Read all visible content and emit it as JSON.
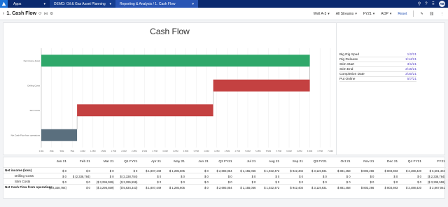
{
  "nav": {
    "apps": "Apps",
    "model": "DEMO: Oil & Gas Asset Planning",
    "page": "Reporting & Analysis / 1. Cash Flow",
    "avatar": "AB"
  },
  "header": {
    "title": "1. Cash Flow",
    "selectors": [
      "Well A-3",
      "All Streams",
      "FY21",
      "AOP"
    ],
    "reset": "Reset"
  },
  "chart_data": {
    "type": "bar",
    "title": "Cash Flow",
    "orientation": "horizontal-waterfall",
    "categories": [
      "Net income (loss)",
      "Drilling Costs",
      "Stim Costs",
      "Net Cash Flow from operations"
    ],
    "bars": [
      {
        "start": 0,
        "end": 6501404,
        "color": "#2fa86a"
      },
      {
        "start": 6501404,
        "end": 4162620,
        "color": "#c44141"
      },
      {
        "start": 4162620,
        "end": 866061,
        "color": "#c44141"
      },
      {
        "start": 0,
        "end": 866061,
        "color": "#5a6f7e"
      }
    ],
    "xlim": [
      0,
      7000000
    ],
    "xticks": [
      "0.00k",
      "250k",
      "500k",
      "750k",
      "1.00M",
      "1.25M",
      "1.50M",
      "1.75M",
      "2.00M",
      "2.25M",
      "2.50M",
      "2.75M",
      "3.00M",
      "3.25M",
      "3.50M",
      "3.75M",
      "4.00M",
      "4.25M",
      "4.50M",
      "4.75M",
      "5.00M",
      "5.25M",
      "5.50M",
      "5.75M",
      "6.00M",
      "6.25M",
      "6.50M",
      "6.75M",
      "7.00M"
    ]
  },
  "timeline": {
    "rows": [
      {
        "label": "Big Rig Spud",
        "value": "1/2/21"
      },
      {
        "label": "Rig Release",
        "value": "1/14/21"
      },
      {
        "label": "Stim Start",
        "value": "3/1/21"
      },
      {
        "label": "Stim End",
        "value": "3/16/21"
      },
      {
        "label": "Completion Date",
        "value": "3/30/21"
      },
      {
        "label": "Put Online",
        "value": "5/7/21"
      }
    ]
  },
  "table": {
    "columns": [
      "Jan 21",
      "Feb 21",
      "Mar 21",
      "Q1 FY21",
      "Apr 21",
      "May 21",
      "Jun 21",
      "Q2 FY21",
      "Jul 21",
      "Aug 21",
      "Sep 21",
      "Q3 FY21",
      "Oct 21",
      "Nov 21",
      "Dec 21",
      "Q4 FY21",
      "FY21"
    ],
    "rows": [
      {
        "label": "Net income (loss)",
        "bold": true,
        "values": [
          "$ 0",
          "$ 0",
          "$ 0",
          "$ 0",
          "$ 1,807,449",
          "$ 1,285,605",
          "$ 0",
          "$ 2,693,054",
          "$ 1,155,056",
          "$ 1,022,472",
          "$ 942,404",
          "$ 3,119,931",
          "$ 881,458",
          "$ 803,266",
          "$ 803,693",
          "$ 2,488,420",
          "$ 6,501,404"
        ]
      },
      {
        "label": "Drilling Costs",
        "bold": false,
        "values": [
          "$ 0",
          "$ (2,338,784)",
          "$ 0",
          "$ (2,338,784)",
          "$ 0",
          "$ 0",
          "$ 0",
          "$ 0",
          "$ 0",
          "$ 0",
          "$ 0",
          "$ 0",
          "$ 0",
          "$ 0",
          "$ 0",
          "$ 0",
          "($ 2,338,784)"
        ]
      },
      {
        "label": "Stim Costs",
        "bold": false,
        "values": [
          "$ 0",
          "$ 0",
          "($ 3,295,559)",
          "($ 3,295,559)",
          "$ 0",
          "$ 0",
          "$ 0",
          "$ 0",
          "$ 0",
          "$ 0",
          "$ 0",
          "$ 0",
          "$ 0",
          "$ 0",
          "$ 0",
          "$ 0",
          "($ 3,295,559)"
        ]
      },
      {
        "label": "Net Cash Flow from operations",
        "bold": true,
        "values": [
          "($ 2,338,784)",
          "$ 0",
          "($ 3,295,559)",
          "($ 5,634,343)",
          "$ 1,807,449",
          "$ 1,285,605",
          "$ 0",
          "$ 2,693,054",
          "$ 1,155,056",
          "$ 1,022,472",
          "$ 942,404",
          "$ 3,119,931",
          "$ 881,458",
          "$ 803,266",
          "$ 803,693",
          "$ 2,488,420",
          "$ 2,867,061"
        ]
      }
    ]
  }
}
